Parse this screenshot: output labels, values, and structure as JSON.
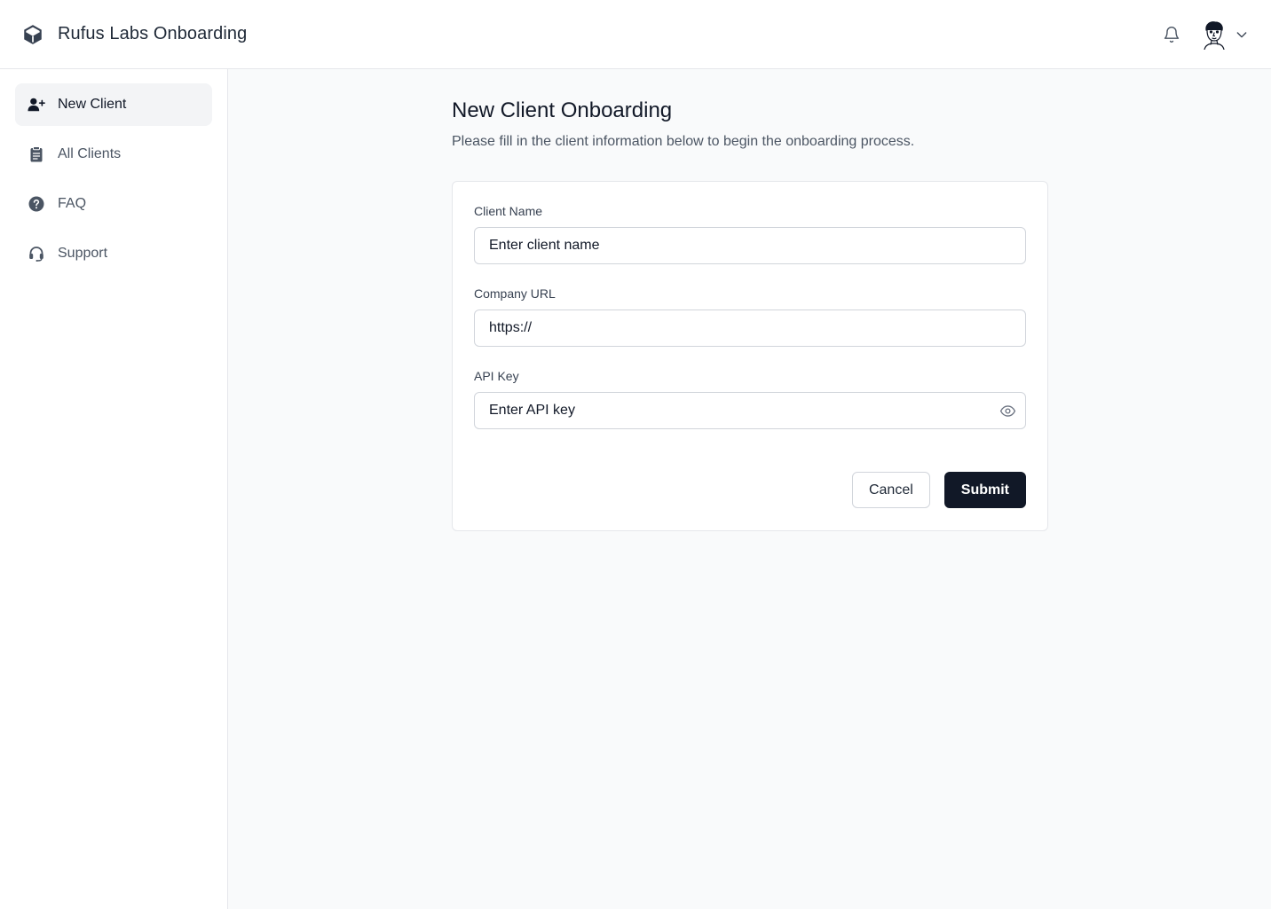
{
  "header": {
    "title": "Rufus Labs Onboarding",
    "logo_icon": "cube-icon",
    "notification_icon": "bell-icon",
    "user_menu_icon": "chevron-down-icon"
  },
  "sidebar": {
    "items": [
      {
        "label": "New Client",
        "icon": "user-plus-icon",
        "active": true
      },
      {
        "label": "All Clients",
        "icon": "clipboard-icon",
        "active": false
      },
      {
        "label": "FAQ",
        "icon": "question-circle-icon",
        "active": false
      },
      {
        "label": "Support",
        "icon": "headset-icon",
        "active": false
      }
    ]
  },
  "main": {
    "title": "New Client Onboarding",
    "subtitle": "Please fill in the client information below to begin the onboarding process.",
    "form": {
      "client_name": {
        "label": "Client Name",
        "placeholder": "Enter client name",
        "value": ""
      },
      "company_url": {
        "label": "Company URL",
        "placeholder": "https://",
        "value": ""
      },
      "api_key": {
        "label": "API Key",
        "placeholder": "Enter API key",
        "value": "",
        "toggle_icon": "eye-icon"
      },
      "cancel_label": "Cancel",
      "submit_label": "Submit"
    }
  },
  "colors": {
    "primary": "#111827",
    "page_background": "#f9fafb",
    "active_nav": "#f3f4f6",
    "border": "#e5e7eb"
  }
}
